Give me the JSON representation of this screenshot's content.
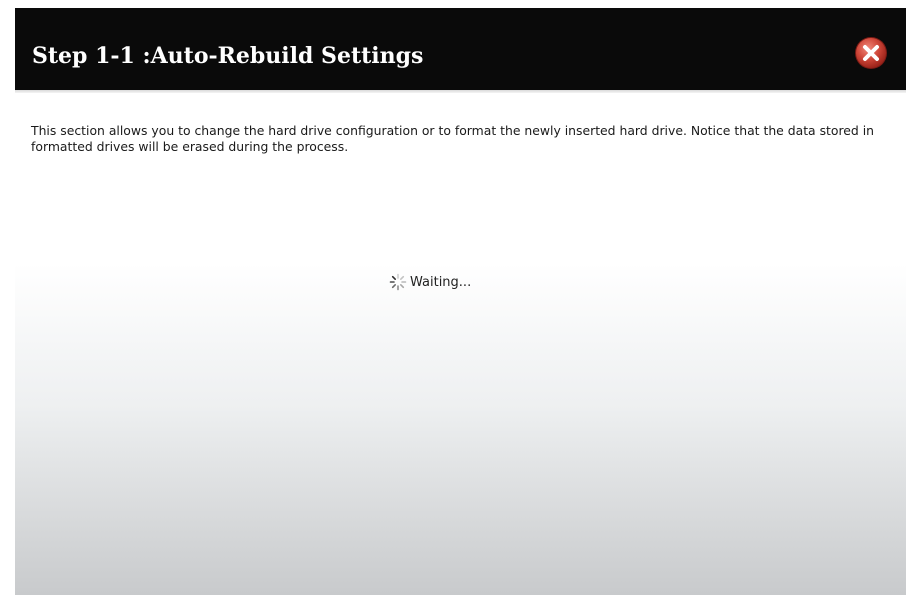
{
  "dialog": {
    "title": "Step 1-1 :Auto-Rebuild Settings",
    "close_icon": "close-x-circle-icon",
    "colors": {
      "titlebar": "#0a0a0a",
      "title_text": "#ffffff",
      "close_button": "#c0392b"
    }
  },
  "content": {
    "description": "This section allows you to change the hard drive configuration or to format the newly inserted hard drive. Notice that the data stored in formatted drives will be erased during the process.",
    "status": {
      "icon": "loading-spinner-icon",
      "text": "Waiting..."
    }
  }
}
